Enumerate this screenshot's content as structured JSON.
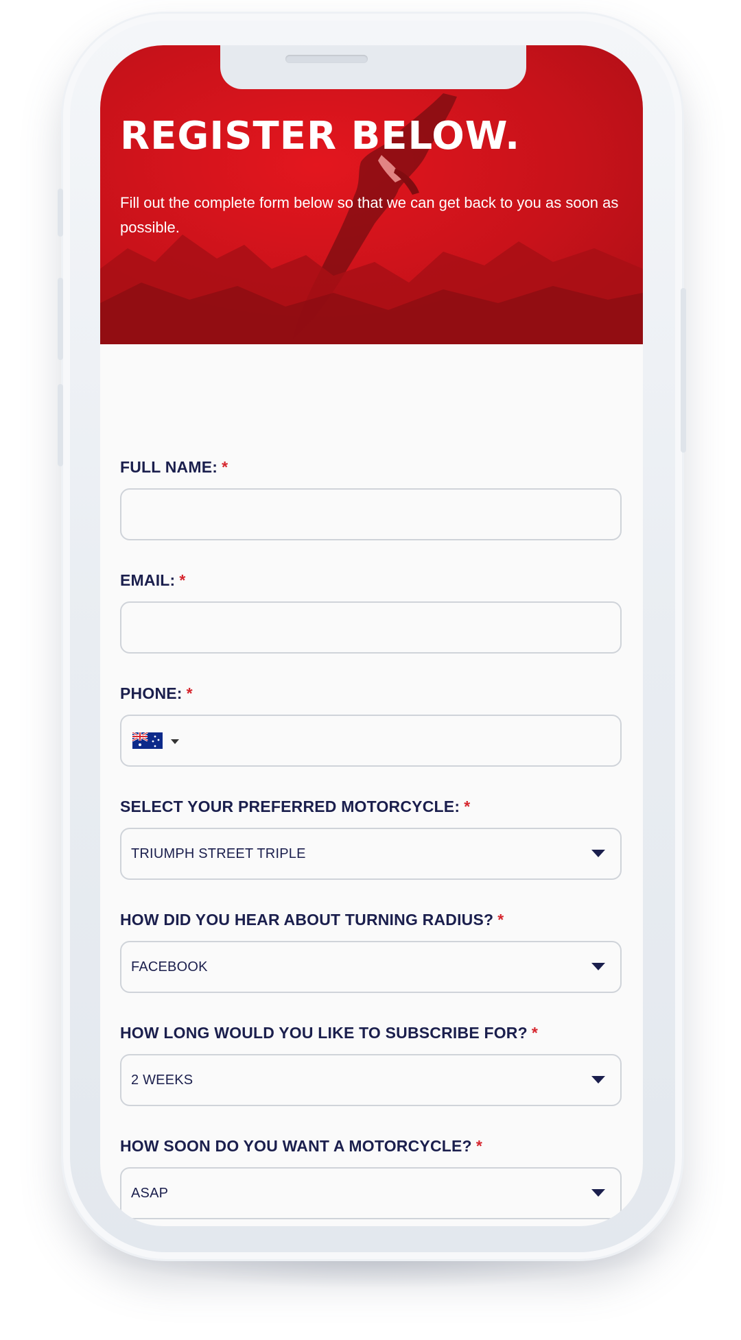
{
  "hero": {
    "title": "REGISTER BELOW.",
    "subtitle": "Fill out the complete form below so that we can get back to you as soon as possible."
  },
  "form": {
    "required_marker": "*",
    "fields": [
      {
        "label": "FULL NAME:",
        "type": "text",
        "value": ""
      },
      {
        "label": "EMAIL:",
        "type": "email",
        "value": ""
      },
      {
        "label": "PHONE:",
        "type": "tel",
        "value": "",
        "country_flag": "australia-flag-icon"
      },
      {
        "label": "SELECT YOUR PREFERRED MOTORCYCLE:",
        "type": "select",
        "value": "TRIUMPH STREET TRIPLE"
      },
      {
        "label": "HOW DID YOU HEAR ABOUT TURNING RADIUS?",
        "type": "select",
        "value": "FACEBOOK"
      },
      {
        "label": "HOW LONG WOULD YOU LIKE TO SUBSCRIBE FOR?",
        "type": "select",
        "value": "2 WEEKS"
      },
      {
        "label": "HOW SOON DO YOU WANT A MOTORCYCLE?",
        "type": "select",
        "value": "ASAP"
      }
    ]
  },
  "colors": {
    "hero_red": "#d8141c",
    "label_navy": "#1b1f4d",
    "required_red": "#d6262e",
    "field_border": "#cfd3d9"
  }
}
